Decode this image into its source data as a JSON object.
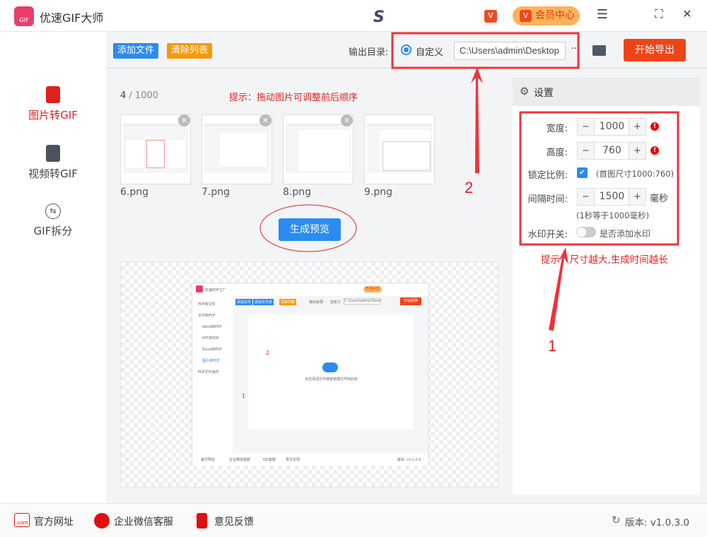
{
  "app": {
    "title": "优速GIF大师",
    "logo_text": "GIF",
    "vip_label": "会员中心",
    "window": {
      "menu": "☰",
      "max": "⛶",
      "close": "✕"
    }
  },
  "sidebar": {
    "items": [
      {
        "label": "图片转GIF",
        "active": true
      },
      {
        "label": "视频转GIF"
      },
      {
        "label": "GIF拆分"
      }
    ]
  },
  "toolbar": {
    "add_files": "添加文件",
    "clear_list": "清除列表",
    "output_label": "输出目录:",
    "radio_label": "自定义",
    "output_path": "C:\\Users\\admin\\Desktop",
    "more": "···",
    "export": "开始导出"
  },
  "list": {
    "count_current": "4",
    "count_max": "/ 1000",
    "hint": "提示：拖动图片可调整前后顺序",
    "files": [
      {
        "name": "6.png"
      },
      {
        "name": "7.png"
      },
      {
        "name": "8.png"
      },
      {
        "name": "9.png"
      }
    ],
    "generate_preview": "生成预览"
  },
  "preview": {
    "app_title": "优速PDF工厂",
    "menu": [
      "PDF转文件",
      "文件转PDF",
      "Word转PDF",
      "PPT转PDF",
      "Excel转PDF",
      "图片转PDF",
      "PDF文件操作"
    ],
    "buttons": [
      "添加文件",
      "添加文件夹",
      "清除列表"
    ],
    "output_label": "输出目录:",
    "radio": "自定义",
    "path": "C:\\Users\\admin\\Deskto",
    "export": "开始转换",
    "vip": "开通会员",
    "drop_hint": "点击添加文件或者拖拽文件到此处",
    "footer": [
      "官方网址",
      "企业微信客服",
      "QQ客服",
      "意见反馈"
    ],
    "version": "版本: v1.2.0.0",
    "annotations": [
      "1",
      "2"
    ]
  },
  "settings": {
    "title": "设置",
    "width_label": "宽度:",
    "width": "1000",
    "height_label": "高度:",
    "height": "760",
    "lock_label": "锁定比例:",
    "lock_checked": true,
    "lock_note": "(首图尺寸1000:760)",
    "interval_label": "间隔时间:",
    "interval": "1500",
    "interval_unit": "毫秒",
    "interval_note": "(1秒等于1000毫秒)",
    "watermark_label": "水印开关:",
    "watermark_on": false,
    "watermark_note": "是否添加水印",
    "hint": "提示：尺寸越大,生成时间越长",
    "minus": "−",
    "plus": "+"
  },
  "annotations": {
    "label1": "1",
    "label2": "2"
  },
  "footer": {
    "links": [
      {
        "label": "官方网址",
        "icon": ".com"
      },
      {
        "label": "企业微信客服"
      },
      {
        "label": "意见反馈"
      }
    ],
    "version": "版本: v1.0.3.0"
  },
  "colors": {
    "accent": "#2b8bf0",
    "export": "#ee4518",
    "annotation": "#e02020",
    "vip": "#fbb35c"
  }
}
